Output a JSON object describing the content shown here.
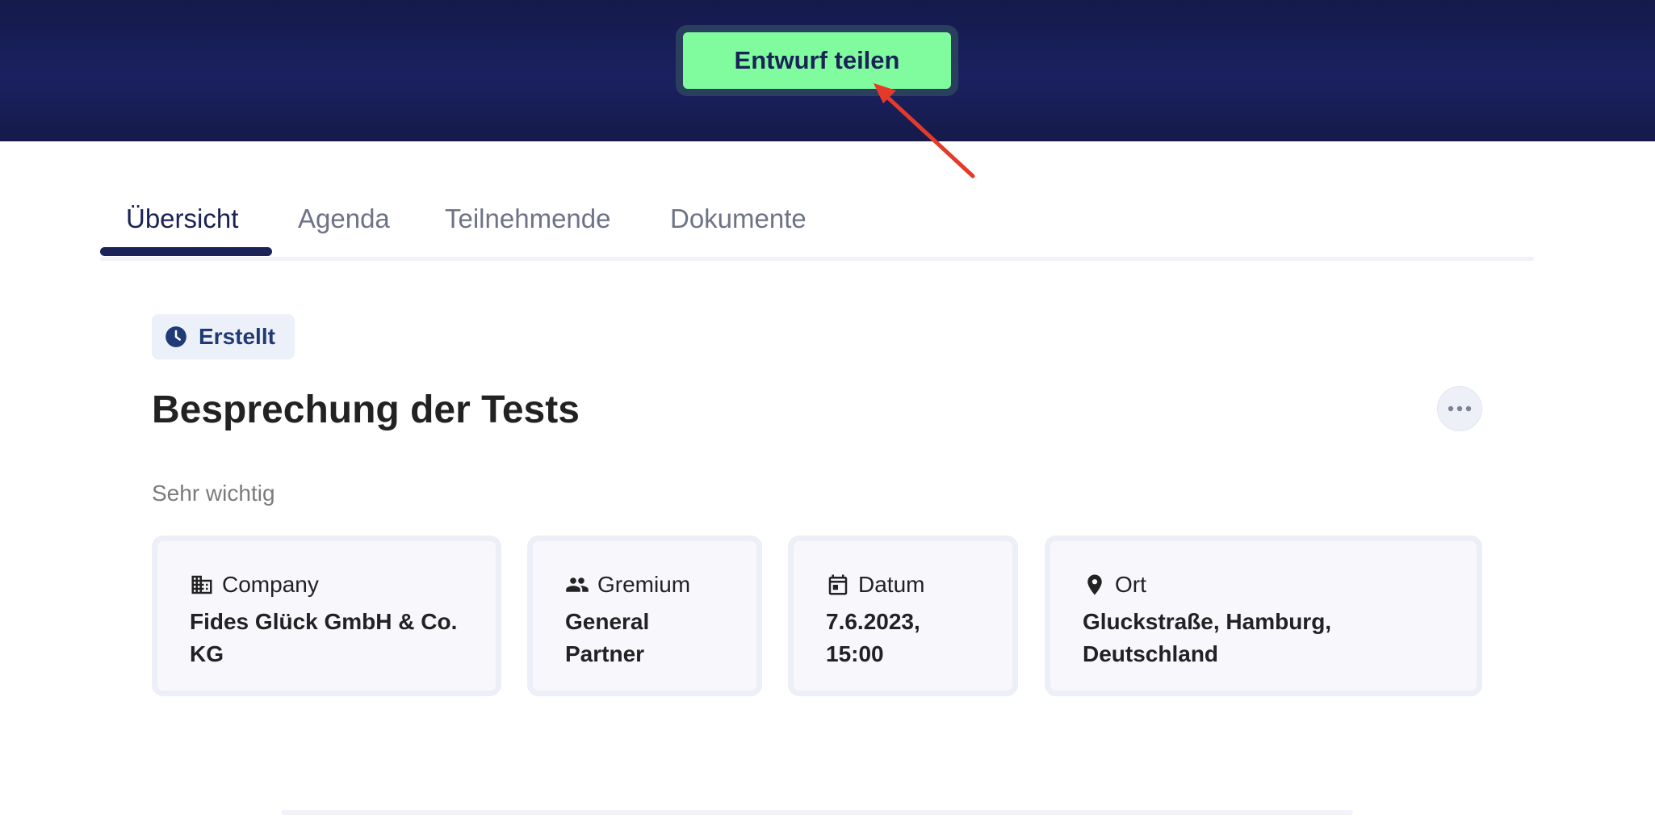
{
  "header": {
    "share_button_label": "Entwurf teilen"
  },
  "tabs": [
    {
      "label": "Übersicht",
      "active": true
    },
    {
      "label": "Agenda",
      "active": false
    },
    {
      "label": "Teilnehmende",
      "active": false
    },
    {
      "label": "Dokumente",
      "active": false
    }
  ],
  "meeting": {
    "status": "Erstellt",
    "title": "Besprechung der Tests",
    "subtitle": "Sehr wichtig"
  },
  "cards": [
    {
      "icon": "building-icon",
      "label": "Company",
      "value_lines": [
        "Fides Glück GmbH & Co.",
        "KG"
      ]
    },
    {
      "icon": "people-icon",
      "label": "Gremium",
      "value_lines": [
        "General",
        "Partner"
      ]
    },
    {
      "icon": "calendar-icon",
      "label": "Datum",
      "value_lines": [
        "7.6.2023,",
        "15:00"
      ]
    },
    {
      "icon": "location-pin-icon",
      "label": "Ort",
      "value_lines": [
        "Gluckstraße, Hamburg,",
        "Deutschland"
      ]
    }
  ],
  "colors": {
    "header_bg": "#1b2160",
    "share_button_bg": "#80fc9f",
    "accent": "#1a2257",
    "status_badge_bg": "#ecf0f9",
    "status_text": "#1f3a75",
    "annotation_arrow": "#e53a2a"
  }
}
